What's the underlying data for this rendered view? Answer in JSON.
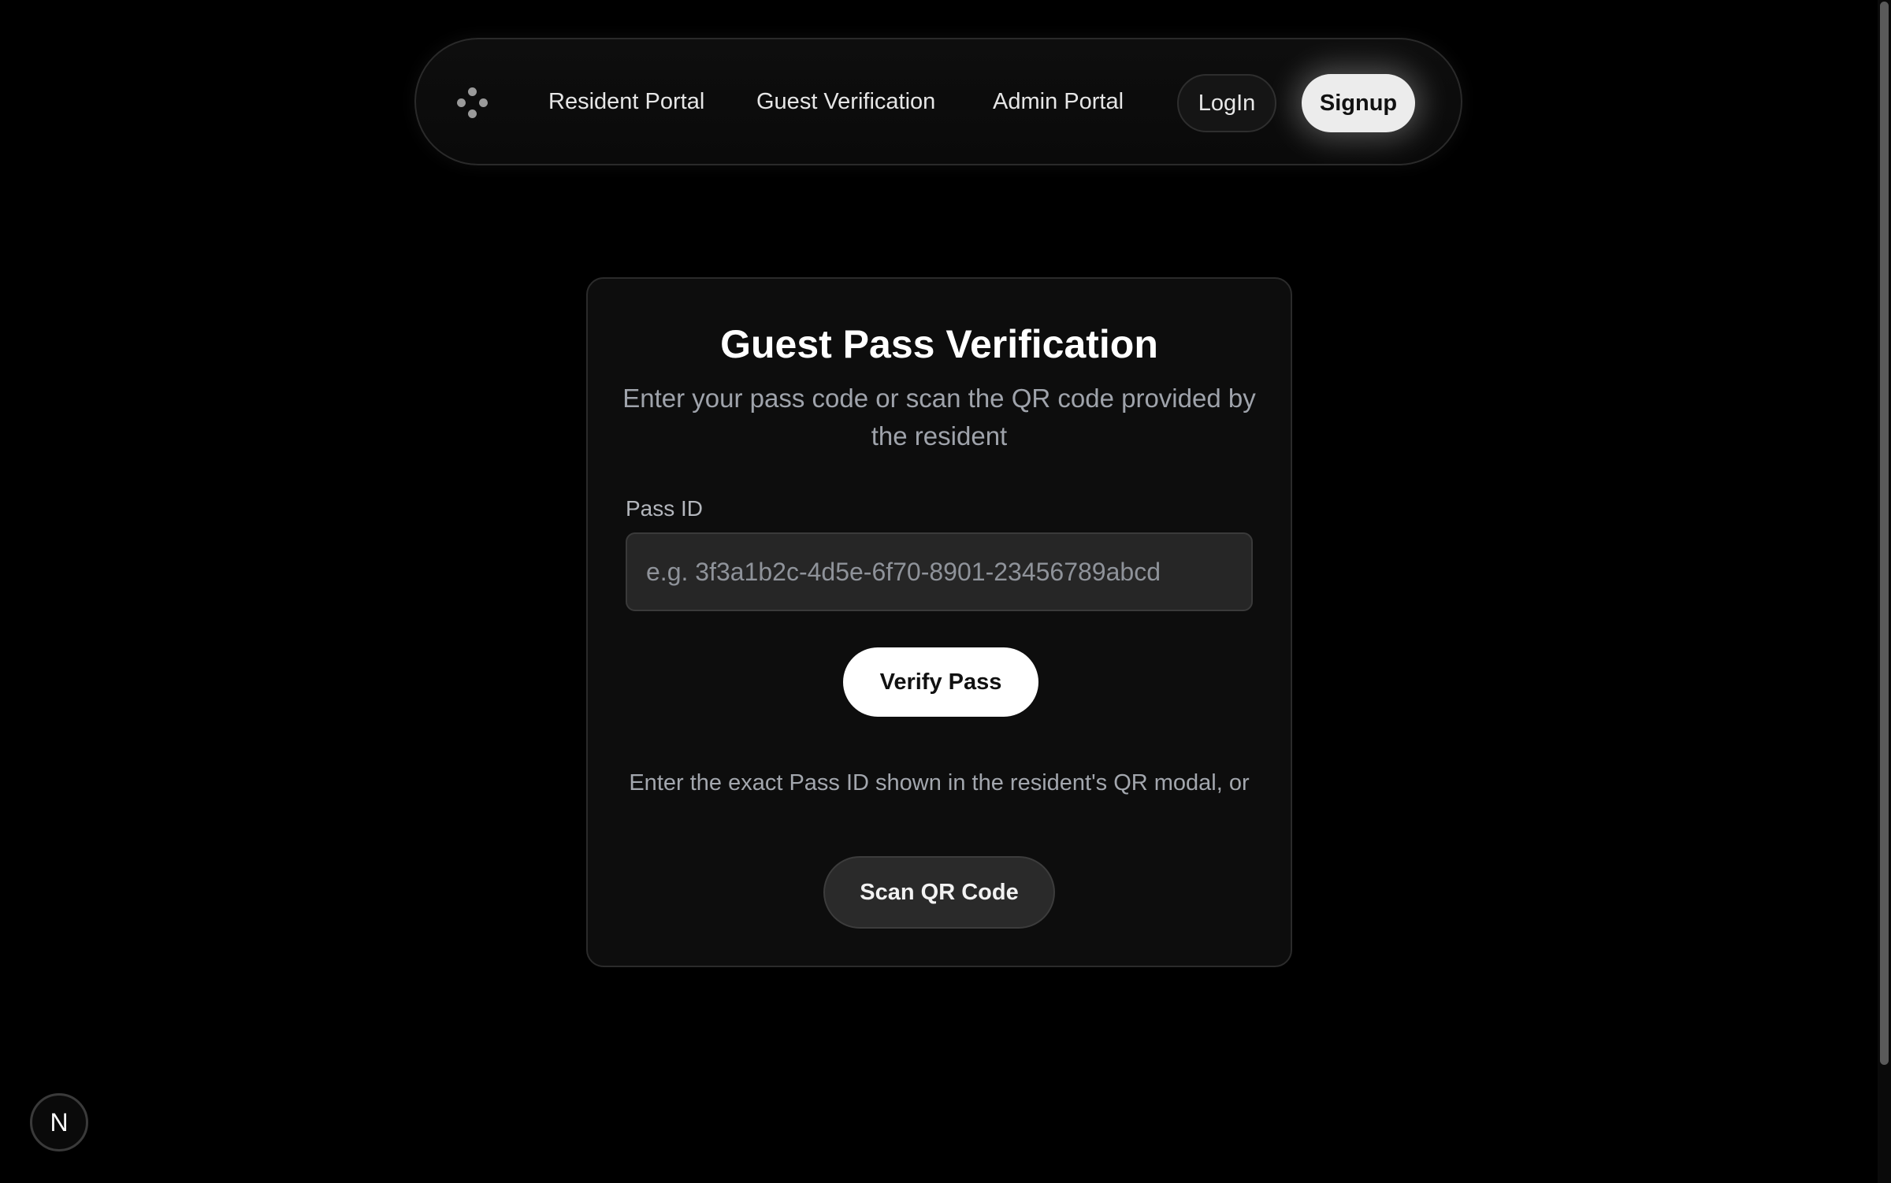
{
  "nav": {
    "logo_icon": "dots-logo-icon",
    "links": [
      {
        "label": "Resident Portal"
      },
      {
        "label": "Guest Verification"
      },
      {
        "label": "Admin Portal"
      }
    ],
    "login_label": "LogIn",
    "signup_label": "Signup"
  },
  "card": {
    "title": "Guest Pass Verification",
    "subtitle": "Enter your pass code or scan the QR code provided by the resident",
    "field_label": "Pass ID",
    "input_value": "",
    "input_placeholder": "e.g. 3f3a1b2c-4d5e-6f70-8901-23456789abcd",
    "verify_label": "Verify Pass",
    "helper_text": "Enter the exact Pass ID shown in the resident's QR modal, or",
    "scan_label": "Scan QR Code"
  },
  "dev_badge": {
    "label": "N",
    "icon": "nextjs-icon"
  },
  "colors": {
    "background": "#000000",
    "card_background": "#0d0d0d",
    "primary_button": "#ffffff",
    "secondary_button": "#2a2a2a",
    "muted_text": "#9fa3ab"
  }
}
